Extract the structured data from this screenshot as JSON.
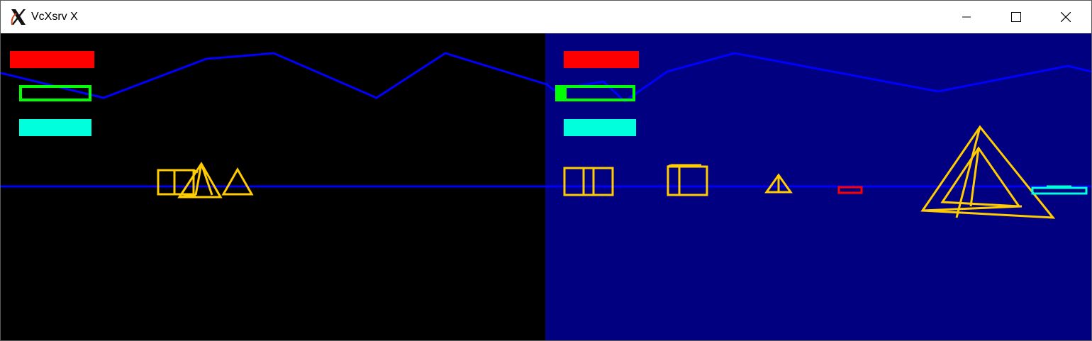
{
  "window": {
    "title": "VcXsrv X",
    "app_icon": "x-logo-icon",
    "controls": [
      "minimize-icon",
      "maximize-icon",
      "close-icon"
    ]
  },
  "scene": {
    "left_view_background": "#000000",
    "right_view_background": "#000080",
    "horizon_color": "#0000ff",
    "object_color": "#ffcc00",
    "hud_colors": {
      "red": "#ff0000",
      "green": "#00ff00",
      "cyan": "#00ffdd"
    }
  }
}
